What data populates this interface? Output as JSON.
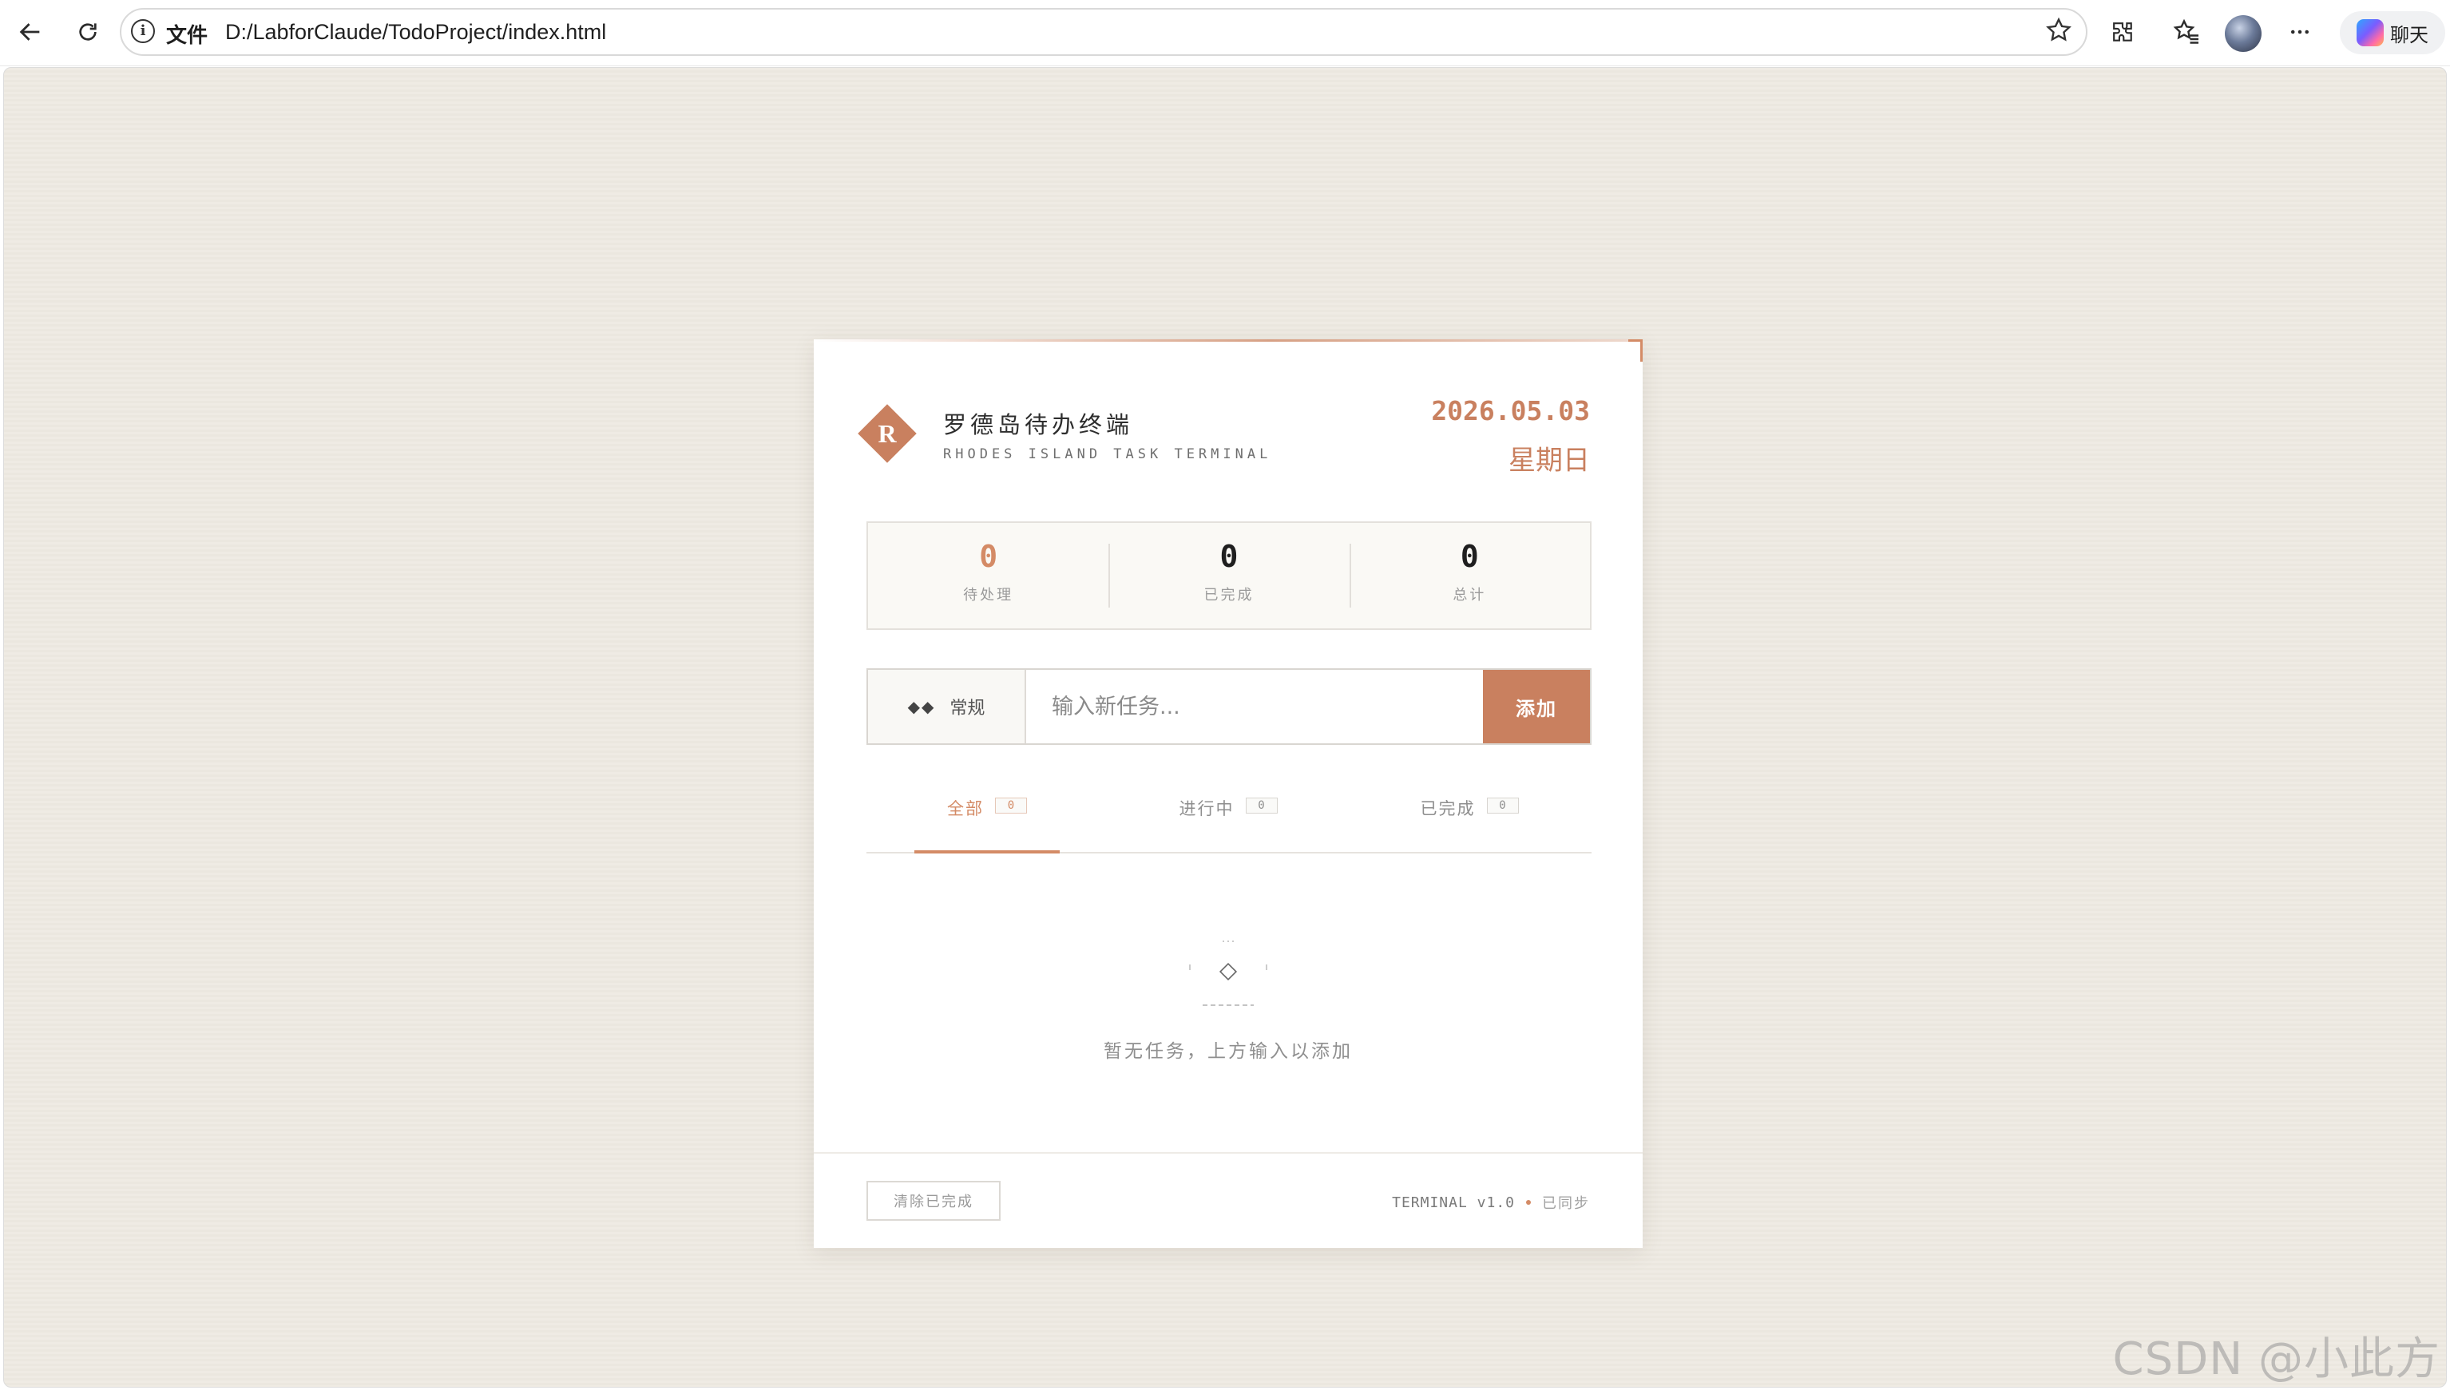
{
  "browser": {
    "file_label": "文件",
    "url": "D:/LabforClaude/TodoProject/index.html",
    "chat_label": "聊天"
  },
  "header": {
    "logo_letter": "R",
    "title": "罗德岛待办终端",
    "subtitle": "RHODES ISLAND TASK TERMINAL",
    "date": "2026.05.03",
    "weekday": "星期日"
  },
  "stats": [
    {
      "value": "0",
      "label": "待处理"
    },
    {
      "value": "0",
      "label": "已完成"
    },
    {
      "value": "0",
      "label": "总计"
    }
  ],
  "input": {
    "priority_icon": "◆◆",
    "priority_label": "常规",
    "placeholder": "输入新任务...",
    "add_label": "添加"
  },
  "tabs": [
    {
      "label": "全部",
      "count": "0",
      "active": true
    },
    {
      "label": "进行中",
      "count": "0",
      "active": false
    },
    {
      "label": "已完成",
      "count": "0",
      "active": false
    }
  ],
  "empty_state": {
    "text": "暂无任务，上方输入以添加"
  },
  "footer": {
    "clear_label": "清除已完成",
    "version": "TERMINAL v1.0",
    "sync_status": "已同步"
  },
  "watermark": "CSDN @小此方",
  "colors": {
    "accent": "#c9805f",
    "accent_light": "#d48b66",
    "page_bg": "#efebe4"
  }
}
